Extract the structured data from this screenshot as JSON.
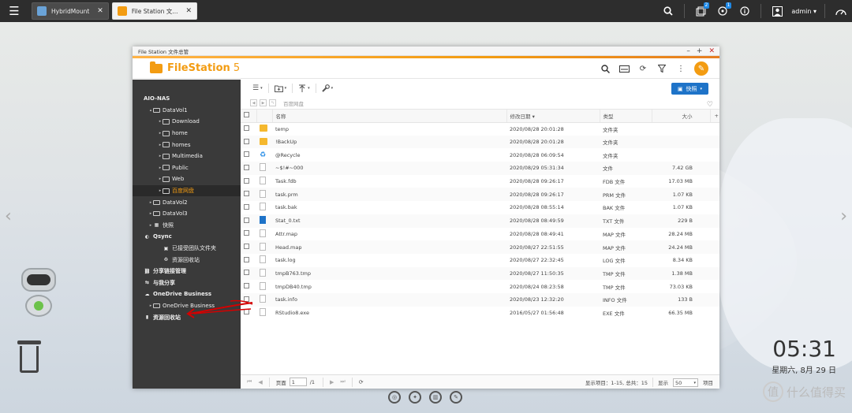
{
  "taskbar": {
    "tabs": [
      {
        "label": "HybridMount",
        "active": false
      },
      {
        "label": "File Station 文...",
        "active": true
      }
    ],
    "notify_badge_1": "2",
    "notify_badge_2": "1",
    "user": "admin"
  },
  "window": {
    "title": "File Station 文件总管",
    "app_name": "FileStation",
    "app_version": "5"
  },
  "toolbar": {
    "quick_label": "快照"
  },
  "path": {
    "current": "百度网盘"
  },
  "sidebar": {
    "items": [
      {
        "label": "AIO-NAS",
        "indent": 0,
        "arrow": "",
        "icon": "none",
        "bold": true,
        "selected": false
      },
      {
        "label": "DataVol1",
        "indent": 1,
        "arrow": "▴",
        "icon": "disk",
        "bold": false,
        "selected": false
      },
      {
        "label": "Download",
        "indent": 2,
        "arrow": "▸",
        "icon": "folder",
        "bold": false,
        "selected": false
      },
      {
        "label": "home",
        "indent": 2,
        "arrow": "▸",
        "icon": "folder",
        "bold": false,
        "selected": false
      },
      {
        "label": "homes",
        "indent": 2,
        "arrow": "▸",
        "icon": "folder",
        "bold": false,
        "selected": false
      },
      {
        "label": "Multimedia",
        "indent": 2,
        "arrow": "▸",
        "icon": "folder",
        "bold": false,
        "selected": false
      },
      {
        "label": "Public",
        "indent": 2,
        "arrow": "▸",
        "icon": "folder",
        "bold": false,
        "selected": false
      },
      {
        "label": "Web",
        "indent": 2,
        "arrow": "▸",
        "icon": "folder",
        "bold": false,
        "selected": false
      },
      {
        "label": "百度网盘",
        "indent": 2,
        "arrow": "▸",
        "icon": "folder",
        "bold": false,
        "selected": true
      },
      {
        "label": "DataVol2",
        "indent": 1,
        "arrow": "▸",
        "icon": "disk",
        "bold": false,
        "selected": false
      },
      {
        "label": "DataVol3",
        "indent": 1,
        "arrow": "▸",
        "icon": "disk",
        "bold": false,
        "selected": false
      },
      {
        "label": "快照",
        "indent": 1,
        "arrow": "▸",
        "icon": "snapshot",
        "bold": false,
        "selected": false
      },
      {
        "label": "Qsync",
        "indent": 0,
        "arrow": "",
        "icon": "qsync",
        "bold": true,
        "selected": false
      },
      {
        "label": "已接受团队文件夹",
        "indent": 2,
        "arrow": "",
        "icon": "team",
        "bold": false,
        "selected": false
      },
      {
        "label": "资源回收站",
        "indent": 2,
        "arrow": "",
        "icon": "recycle",
        "bold": false,
        "selected": false
      },
      {
        "label": "分享链接管理",
        "indent": 0,
        "arrow": "",
        "icon": "link",
        "bold": true,
        "selected": false
      },
      {
        "label": "与我分享",
        "indent": 0,
        "arrow": "",
        "icon": "share",
        "bold": true,
        "selected": false
      },
      {
        "label": "OneDrive Business",
        "indent": 0,
        "arrow": "",
        "icon": "cloud",
        "bold": true,
        "selected": false
      },
      {
        "label": "OneDrive Business",
        "indent": 1,
        "arrow": "▸",
        "icon": "disk",
        "bold": false,
        "selected": false
      },
      {
        "label": "资源回收站",
        "indent": 0,
        "arrow": "",
        "icon": "bin",
        "bold": true,
        "selected": false
      }
    ]
  },
  "table": {
    "headers": {
      "name": "名称",
      "modified": "修改日期",
      "type": "类型",
      "size": "大小"
    },
    "rows": [
      {
        "icon": "folder",
        "name": "temp",
        "modified": "2020/08/28 20:01:28",
        "type": "文件夹",
        "size": ""
      },
      {
        "icon": "folder",
        "name": "!BackUp",
        "modified": "2020/08/28 20:01:28",
        "type": "文件夹",
        "size": ""
      },
      {
        "icon": "recycle",
        "name": "@Recycle",
        "modified": "2020/08/28 06:09:54",
        "type": "文件夹",
        "size": ""
      },
      {
        "icon": "file",
        "name": "~$!#~000",
        "modified": "2020/08/29 05:31:34",
        "type": "文件",
        "size": "7.42 GB"
      },
      {
        "icon": "file",
        "name": "Task.fdb",
        "modified": "2020/08/28 09:26:17",
        "type": "FDB 文件",
        "size": "17.03 MB"
      },
      {
        "icon": "file",
        "name": "task.prm",
        "modified": "2020/08/28 09:26:17",
        "type": "PRM 文件",
        "size": "1.07 KB"
      },
      {
        "icon": "file",
        "name": "task.bak",
        "modified": "2020/08/28 08:55:14",
        "type": "BAK 文件",
        "size": "1.07 KB"
      },
      {
        "icon": "txt",
        "name": "Stat_0.txt",
        "modified": "2020/08/28 08:49:59",
        "type": "TXT 文件",
        "size": "229 B"
      },
      {
        "icon": "file",
        "name": "Attr.map",
        "modified": "2020/08/28 08:49:41",
        "type": "MAP 文件",
        "size": "28.24 MB"
      },
      {
        "icon": "file",
        "name": "Head.map",
        "modified": "2020/08/27 22:51:55",
        "type": "MAP 文件",
        "size": "24.24 MB"
      },
      {
        "icon": "file",
        "name": "task.log",
        "modified": "2020/08/27 22:32:45",
        "type": "LOG 文件",
        "size": "8.34 KB"
      },
      {
        "icon": "file",
        "name": "tmpB763.tmp",
        "modified": "2020/08/27 11:50:35",
        "type": "TMP 文件",
        "size": "1.38 MB"
      },
      {
        "icon": "file",
        "name": "tmpDB40.tmp",
        "modified": "2020/08/24 08:23:58",
        "type": "TMP 文件",
        "size": "73.03 KB"
      },
      {
        "icon": "file",
        "name": "task.info",
        "modified": "2020/08/23 12:32:20",
        "type": "INFO 文件",
        "size": "133 B"
      },
      {
        "icon": "file",
        "name": "RStudio8.exe",
        "modified": "2016/05/27 01:56:48",
        "type": "EXE 文件",
        "size": "66.35 MB"
      }
    ]
  },
  "pager": {
    "page_label": "页面",
    "page_value": "1",
    "page_total": "/1",
    "summary": "显示项目：1-15, 总共：15",
    "display_label": "显示",
    "per_page": "50",
    "items_label": "项目"
  },
  "desktop": {
    "time": "05:31",
    "date": "星期六, 8月 29 日",
    "watermark": "什么值得买"
  }
}
